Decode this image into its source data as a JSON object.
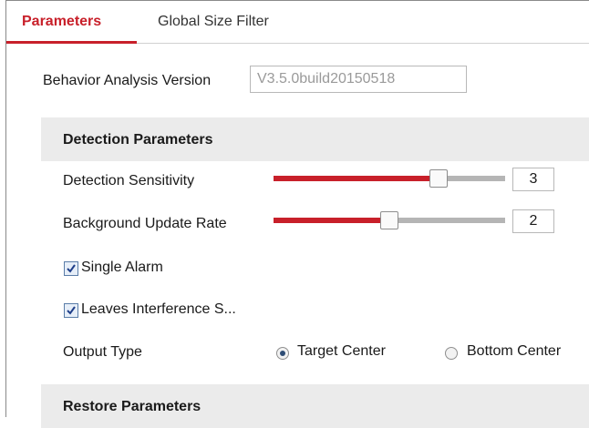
{
  "tabs": [
    {
      "label": "Parameters",
      "active": true
    },
    {
      "label": "Global Size Filter",
      "active": false
    }
  ],
  "behavior_analysis_version": {
    "label": "Behavior Analysis Version",
    "value": "V3.5.0build20150518"
  },
  "detection_parameters": {
    "title": "Detection Parameters",
    "detection_sensitivity": {
      "label": "Detection Sensitivity",
      "value": "3",
      "slider_fraction": 0.73
    },
    "background_update_rate": {
      "label": "Background Update Rate",
      "value": "2",
      "slider_fraction": 0.5
    },
    "single_alarm": {
      "label": "Single Alarm",
      "checked": true
    },
    "leaves_interference": {
      "label": "Leaves Interference S...",
      "checked": true
    },
    "output_type": {
      "label": "Output Type",
      "options": [
        "Target Center",
        "Bottom Center"
      ],
      "selected": "Target Center"
    }
  },
  "restore_parameters": {
    "title": "Restore Parameters"
  },
  "colors": {
    "accent": "#c8202a",
    "track": "#b5b5b5",
    "section_bg": "#ebebeb"
  }
}
